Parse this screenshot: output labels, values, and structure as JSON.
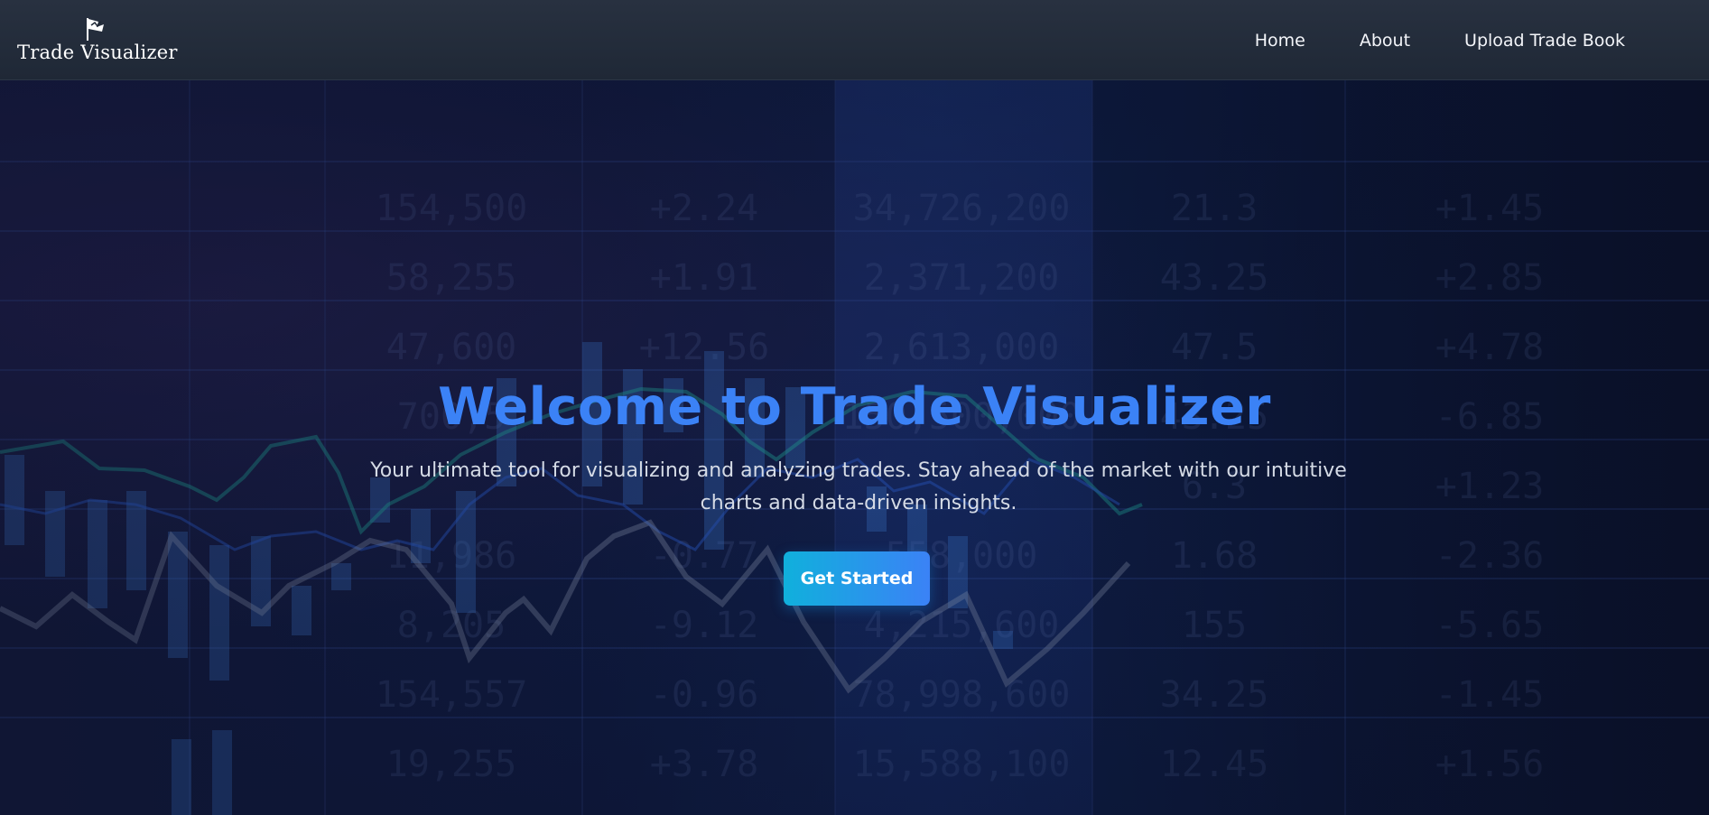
{
  "navbar": {
    "brand_name": "Trade Visualizer",
    "brand_icon": "flag-chart-icon",
    "links": [
      {
        "label": "Home"
      },
      {
        "label": "About"
      },
      {
        "label": "Upload Trade Book"
      }
    ]
  },
  "hero": {
    "title": "Welcome to Trade Visualizer",
    "subtitle": "Your ultimate tool for visualizing and analyzing trades. Stay ahead of the market with our intuitive charts and data-driven insights.",
    "cta_label": "Get Started",
    "background_ticker": [
      [
        "154,500",
        "+2.24",
        "34,726,200",
        "21.3",
        "+1.45"
      ],
      [
        "58,255",
        "+1.91",
        "2,371,200",
        "43.25",
        "+2.85"
      ],
      [
        "47,600",
        "+12.56",
        "2,613,000",
        "47.5",
        "+4.78"
      ],
      [
        "700,5",
        "",
        "150,500,000",
        "43.25",
        "-6.85"
      ],
      [
        "",
        "",
        "",
        "6.3",
        "+1.23"
      ],
      [
        "11,986",
        "-0.77",
        "558,000",
        "1.68",
        "-2.36"
      ],
      [
        "8,205",
        "-9.12",
        "4,215,600",
        "155",
        "-5.65"
      ],
      [
        "154,557",
        "-0.96",
        "78,998,600",
        "34.25",
        "-1.45"
      ],
      [
        "19,255",
        "+3.78",
        "15,588,100",
        "12.45",
        "+1.56"
      ]
    ]
  },
  "colors": {
    "accent": "#3b82f6",
    "cta_start": "#10b0dc",
    "cta_end": "#3b82f6",
    "navbar": "#222b39"
  }
}
